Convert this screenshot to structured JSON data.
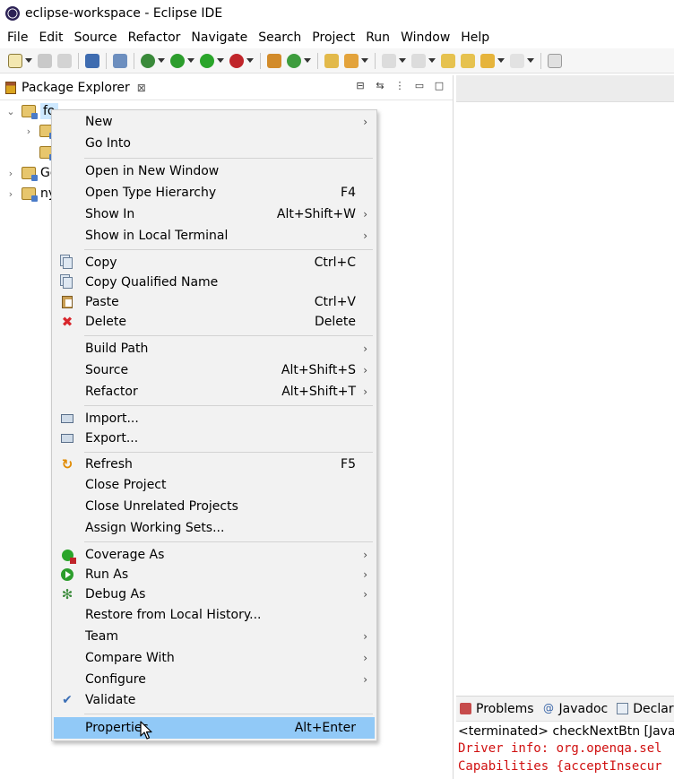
{
  "window": {
    "title": "eclipse-workspace - Eclipse IDE",
    "icon": "eclipse-icon"
  },
  "menubar": [
    "File",
    "Edit",
    "Source",
    "Refactor",
    "Navigate",
    "Search",
    "Project",
    "Run",
    "Window",
    "Help"
  ],
  "package_explorer": {
    "title": "Package Explorer",
    "close_glyph": "⊠",
    "tree": [
      {
        "label": "fo",
        "expanded": true,
        "selected": true
      },
      {
        "label": "Ge",
        "expanded": false
      },
      {
        "label": "ny",
        "expanded": false
      }
    ]
  },
  "context_menu": {
    "items": [
      {
        "label": "New",
        "shortcut": "",
        "submenu": true,
        "icon": ""
      },
      {
        "label": "Go Into",
        "shortcut": "",
        "submenu": false,
        "icon": ""
      },
      {
        "label": "Open in New Window",
        "shortcut": "",
        "submenu": false,
        "icon": ""
      },
      {
        "label": "Open Type Hierarchy",
        "shortcut": "F4",
        "submenu": false,
        "icon": ""
      },
      {
        "label": "Show In",
        "shortcut": "Alt+Shift+W",
        "submenu": true,
        "icon": ""
      },
      {
        "label": "Show in Local Terminal",
        "shortcut": "",
        "submenu": true,
        "icon": ""
      },
      {
        "label": "Copy",
        "shortcut": "Ctrl+C",
        "submenu": false,
        "icon": "copy-icon"
      },
      {
        "label": "Copy Qualified Name",
        "shortcut": "",
        "submenu": false,
        "icon": "copy-qualified-name-icon"
      },
      {
        "label": "Paste",
        "shortcut": "Ctrl+V",
        "submenu": false,
        "icon": "paste-icon"
      },
      {
        "label": "Delete",
        "shortcut": "Delete",
        "submenu": false,
        "icon": "delete-icon"
      },
      {
        "label": "Build Path",
        "shortcut": "",
        "submenu": true,
        "icon": ""
      },
      {
        "label": "Source",
        "shortcut": "Alt+Shift+S",
        "submenu": true,
        "icon": ""
      },
      {
        "label": "Refactor",
        "shortcut": "Alt+Shift+T",
        "submenu": true,
        "icon": ""
      },
      {
        "label": "Import...",
        "shortcut": "",
        "submenu": false,
        "icon": "import-icon"
      },
      {
        "label": "Export...",
        "shortcut": "",
        "submenu": false,
        "icon": "export-icon"
      },
      {
        "label": "Refresh",
        "shortcut": "F5",
        "submenu": false,
        "icon": "refresh-icon"
      },
      {
        "label": "Close Project",
        "shortcut": "",
        "submenu": false,
        "icon": ""
      },
      {
        "label": "Close Unrelated Projects",
        "shortcut": "",
        "submenu": false,
        "icon": ""
      },
      {
        "label": "Assign Working Sets...",
        "shortcut": "",
        "submenu": false,
        "icon": ""
      },
      {
        "label": "Coverage As",
        "shortcut": "",
        "submenu": true,
        "icon": "coverage-icon"
      },
      {
        "label": "Run As",
        "shortcut": "",
        "submenu": true,
        "icon": "run-icon"
      },
      {
        "label": "Debug As",
        "shortcut": "",
        "submenu": true,
        "icon": "debug-icon"
      },
      {
        "label": "Restore from Local History...",
        "shortcut": "",
        "submenu": false,
        "icon": ""
      },
      {
        "label": "Team",
        "shortcut": "",
        "submenu": true,
        "icon": ""
      },
      {
        "label": "Compare With",
        "shortcut": "",
        "submenu": true,
        "icon": ""
      },
      {
        "label": "Configure",
        "shortcut": "",
        "submenu": true,
        "icon": ""
      },
      {
        "label": "Validate",
        "shortcut": "",
        "submenu": false,
        "icon": "validate-icon"
      },
      {
        "label": "Properties",
        "shortcut": "Alt+Enter",
        "submenu": false,
        "icon": "",
        "highlighted": true
      }
    ]
  },
  "console": {
    "tabs": [
      {
        "label": "Problems",
        "icon": "problems-icon"
      },
      {
        "label": "Javadoc",
        "icon": "javadoc-icon"
      },
      {
        "label": "Declara",
        "icon": "declaration-icon"
      }
    ],
    "status": "<terminated> checkNextBtn [Java Ap",
    "lines": [
      "Driver info: org.openqa.sel",
      "Capabilities {acceptInsecur"
    ],
    "error_color": "#d01010"
  },
  "colors": {
    "selection": "#cde8ff",
    "menu_highlight": "#91c9f7",
    "menu_bg": "#f2f2f2"
  }
}
